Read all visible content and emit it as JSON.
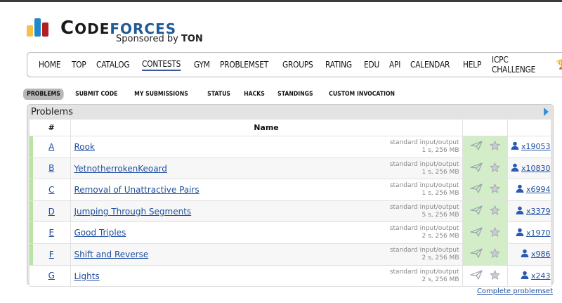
{
  "logo": {
    "code": "C",
    "code_small": "ODE",
    "forces": "FORCES",
    "sponsor_prefix": "Sponsored by",
    "sponsor_name": "TON",
    "colors": {
      "yellow": "#f6c142",
      "blue": "#1f8acb",
      "red": "#b11e26"
    }
  },
  "nav": {
    "items": [
      "HOME",
      "TOP",
      "CATALOG",
      "CONTESTS",
      "GYM",
      "PROBLEMSET",
      "GROUPS",
      "RATING",
      "EDU",
      "API",
      "CALENDAR",
      "HELP",
      "ICPC CHALLENGE"
    ],
    "active": "CONTESTS",
    "trophy_icon": "trophy-icon"
  },
  "subtabs": {
    "items": [
      "PROBLEMS",
      "SUBMIT CODE",
      "MY SUBMISSIONS",
      "STATUS",
      "HACKS",
      "STANDINGS",
      "CUSTOM INVOCATION"
    ],
    "active": "PROBLEMS"
  },
  "problems": {
    "title": "Problems",
    "col_index": "#",
    "col_name": "Name",
    "rows": [
      {
        "index": "A",
        "name": "Rook",
        "io": "standard input/output",
        "limits": "1 s, 256 MB",
        "solved": "x19053",
        "accepted": true
      },
      {
        "index": "B",
        "name": "YetnotherrokenKeoard",
        "io": "standard input/output",
        "limits": "1 s, 256 MB",
        "solved": "x10830",
        "accepted": true
      },
      {
        "index": "C",
        "name": "Removal of Unattractive Pairs",
        "io": "standard input/output",
        "limits": "1 s, 256 MB",
        "solved": "x6994",
        "accepted": true
      },
      {
        "index": "D",
        "name": "Jumping Through Segments",
        "io": "standard input/output",
        "limits": "5 s, 256 MB",
        "solved": "x3379",
        "accepted": true
      },
      {
        "index": "E",
        "name": "Good Triples",
        "io": "standard input/output",
        "limits": "2 s, 256 MB",
        "solved": "x1970",
        "accepted": true
      },
      {
        "index": "F",
        "name": "Shift and Reverse",
        "io": "standard input/output",
        "limits": "2 s, 256 MB",
        "solved": "x986",
        "accepted": true
      },
      {
        "index": "G",
        "name": "Lights",
        "io": "standard input/output",
        "limits": "2 s, 256 MB",
        "solved": "x243",
        "accepted": false
      }
    ],
    "complete_link": "Complete problemset",
    "accent_color": "#b9e3a2",
    "status_color": "#d4edc9"
  }
}
